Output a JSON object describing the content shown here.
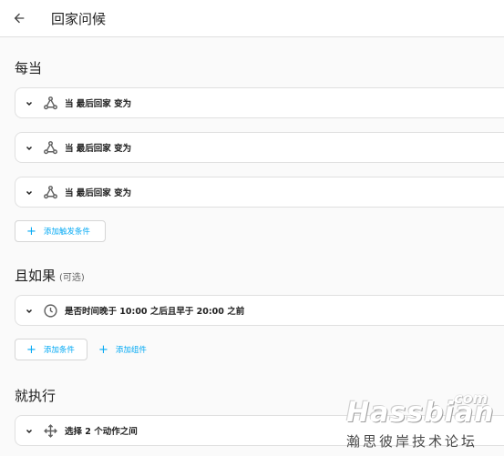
{
  "header": {
    "title": "回家问候"
  },
  "triggers": {
    "title": "每当",
    "items": [
      {
        "label": "当 最后回家 变为"
      },
      {
        "label": "当 最后回家 变为"
      },
      {
        "label": "当 最后回家 变为"
      }
    ],
    "add_label": "添加触发条件"
  },
  "conditions": {
    "title": "且如果",
    "optional": "(可选)",
    "items": [
      {
        "label": "是否时间晚于 10:00 之后且早于 20:00 之前"
      }
    ],
    "add_condition_label": "添加条件",
    "add_block_label": "添加组件"
  },
  "actions": {
    "title": "就执行",
    "items": [
      {
        "label": "选择 2 个动作之间"
      }
    ]
  },
  "watermark": {
    "com": ".com",
    "brand": "Hassbian",
    "subtitle": "瀚思彼岸技术论坛"
  },
  "colors": {
    "accent": "#03a9f4"
  }
}
